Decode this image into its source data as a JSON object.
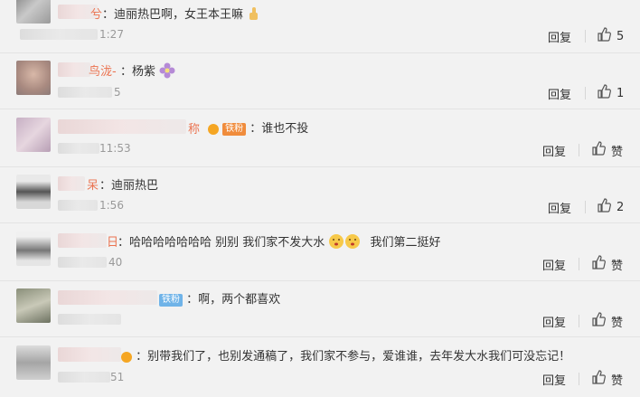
{
  "comments": [
    {
      "name_tail": "兮",
      "text": "：迪丽热巴啊，女王本王嘛",
      "time_tail": "1:27",
      "reply": "回复",
      "likes": "5"
    },
    {
      "name_tail": "鸟泷-",
      "text": "：杨紫",
      "time_tail": "5",
      "reply": "回复",
      "likes": "1"
    },
    {
      "name_tail": "称",
      "badge": "铁粉",
      "text": "：谁也不投",
      "time_tail": "11:53",
      "reply": "回复",
      "likes": "赞"
    },
    {
      "name_tail": "呆",
      "text": "：迪丽热巴",
      "time_tail": "1:56",
      "reply": "回复",
      "likes": "2"
    },
    {
      "name_tail": "日",
      "text": "：哈哈哈哈哈哈哈  别别  我们家不发大水",
      "text2": "我们第二挺好",
      "time_tail": "40",
      "reply": "回复",
      "likes": "赞"
    },
    {
      "badge": "铁粉",
      "text": "：啊，两个都喜欢",
      "reply": "回复",
      "likes": "赞"
    },
    {
      "text": "：别带我们了，也别发通稿了，我们家不参与，爱谁谁，去年发大水我们可没忘记！",
      "time_tail": "51",
      "reply": "回复",
      "likes": "赞"
    }
  ],
  "colors": {
    "accent": "#eb7350",
    "text": "#333333",
    "time": "#999999",
    "badge_orange": "#f08c3c",
    "badge_blue": "#6fb3e8"
  },
  "icons": {
    "like": "thumbs-up-icon",
    "emoji": [
      "thumbs-up-emoji",
      "flower-emoji",
      "blush-emoji"
    ]
  }
}
